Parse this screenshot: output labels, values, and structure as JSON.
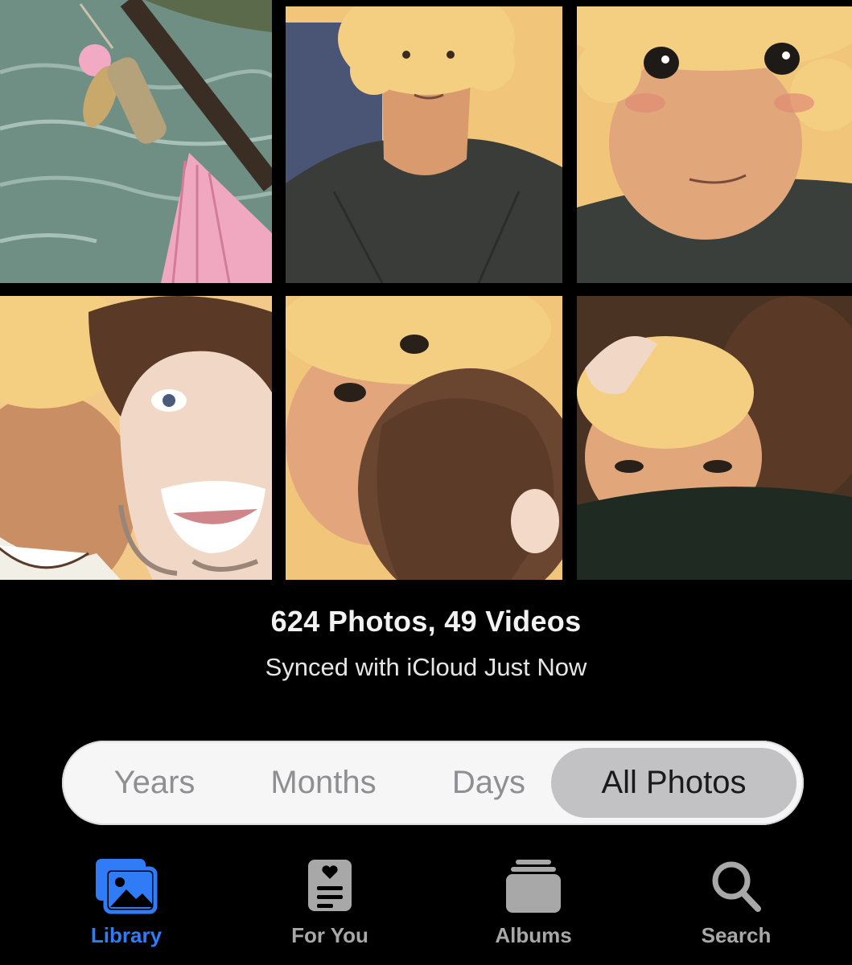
{
  "library": {
    "photos": [
      {
        "name": "lure-on-rod-illustration"
      },
      {
        "name": "curly-hair-portrait-illustration"
      },
      {
        "name": "curly-hair-closeup-illustration"
      },
      {
        "name": "selfie-two-people-illustration"
      },
      {
        "name": "cheek-kiss-illustration"
      },
      {
        "name": "hug-illustration"
      }
    ],
    "count_text": "624 Photos, 49 Videos",
    "sync_text": "Synced with iCloud Just Now"
  },
  "view_picker": {
    "options": [
      "Years",
      "Months",
      "Days",
      "All Photos"
    ],
    "selected": "All Photos"
  },
  "tabbar": {
    "active_color": "#2f7cf6",
    "inactive_color": "#a8a8a8",
    "tabs": [
      {
        "label": "Library",
        "icon": "photo-library-icon",
        "active": true
      },
      {
        "label": "For You",
        "icon": "for-you-icon",
        "active": false
      },
      {
        "label": "Albums",
        "icon": "albums-icon",
        "active": false
      },
      {
        "label": "Search",
        "icon": "magnifier-icon",
        "active": false
      }
    ]
  }
}
